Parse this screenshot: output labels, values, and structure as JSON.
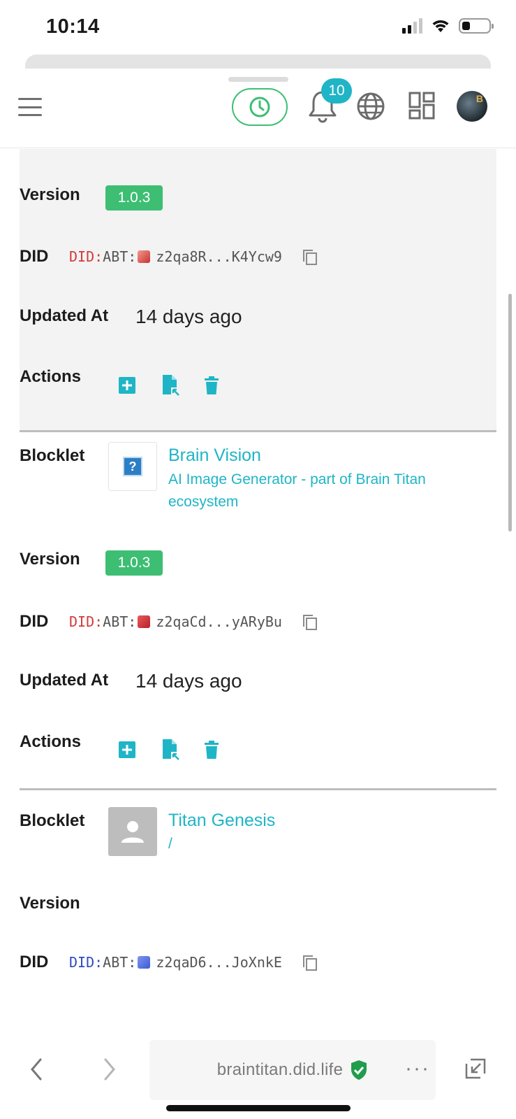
{
  "status_bar": {
    "time": "10:14"
  },
  "header": {
    "notification_count": "10",
    "icons": [
      "menu-icon",
      "clock-icon",
      "bell-icon",
      "globe-icon",
      "apps-icon",
      "avatar"
    ]
  },
  "labels": {
    "blocklet": "Blocklet",
    "version": "Version",
    "did": "DID",
    "updated_at": "Updated At",
    "actions": "Actions"
  },
  "blocklets": [
    {
      "version": "1.0.3",
      "did_prefix": "DID:",
      "did_rest": "ABT:",
      "did_short": "z2qa8R...K4Ycw9",
      "updated": "14 days ago"
    },
    {
      "title": "Brain Vision",
      "description": "AI Image Generator - part of Brain Titan ecosystem",
      "version": "1.0.3",
      "did_prefix": "DID:",
      "did_rest": "ABT:",
      "did_short": "z2qaCd...yARyBu",
      "updated": "14 days ago"
    },
    {
      "title": "Titan Genesis",
      "description": "/",
      "version": "",
      "did_prefix": "DID:",
      "did_rest": "ABT:",
      "did_short": "z2qaD6...JoXnkE"
    }
  ],
  "browser": {
    "url": "braintitan.did.life",
    "more": "···"
  },
  "colors": {
    "accent": "#1fb5c6",
    "version_pill": "#3dbe73",
    "did_red": "#d23a3a",
    "did_blue": "#2e4cc4"
  }
}
